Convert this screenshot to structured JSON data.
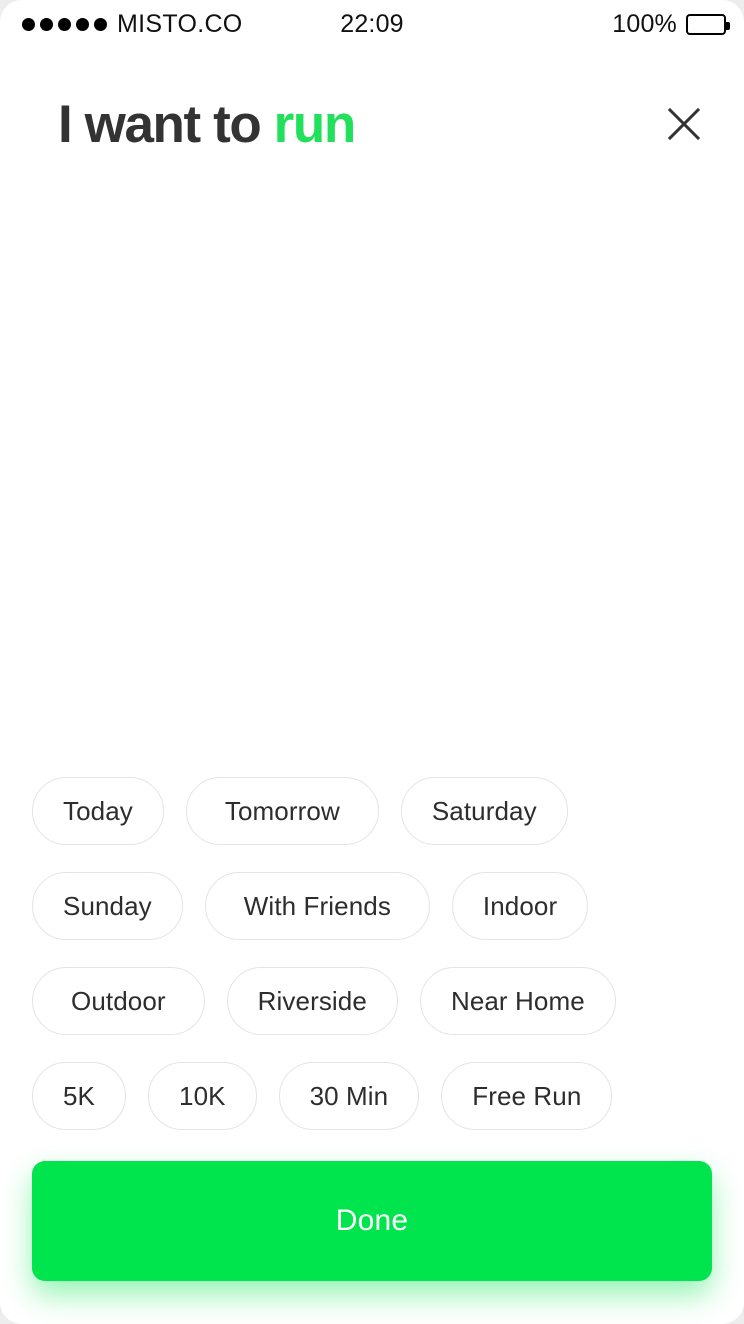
{
  "status_bar": {
    "signal_dots": 5,
    "carrier": "MISTO.CO",
    "time": "22:09",
    "battery_percent": "100%"
  },
  "header": {
    "title_prefix": "I want to ",
    "title_accent": "run",
    "close_icon": "close-icon"
  },
  "chips": [
    [
      {
        "label": "Today"
      },
      {
        "label": "Tomorrow"
      },
      {
        "label": "Saturday"
      }
    ],
    [
      {
        "label": "Sunday"
      },
      {
        "label": "With Friends"
      },
      {
        "label": "Indoor"
      }
    ],
    [
      {
        "label": "Outdoor"
      },
      {
        "label": "Riverside"
      },
      {
        "label": "Near Home"
      }
    ],
    [
      {
        "label": "5K"
      },
      {
        "label": "10K"
      },
      {
        "label": "30 Min"
      },
      {
        "label": "Free Run"
      }
    ]
  ],
  "footer": {
    "done_label": "Done"
  },
  "colors": {
    "accent_green": "#22E05C",
    "button_green": "#00E54D",
    "title_dark": "#333333",
    "chip_border": "#E4E4E4",
    "chip_text": "#2d2d2d"
  }
}
